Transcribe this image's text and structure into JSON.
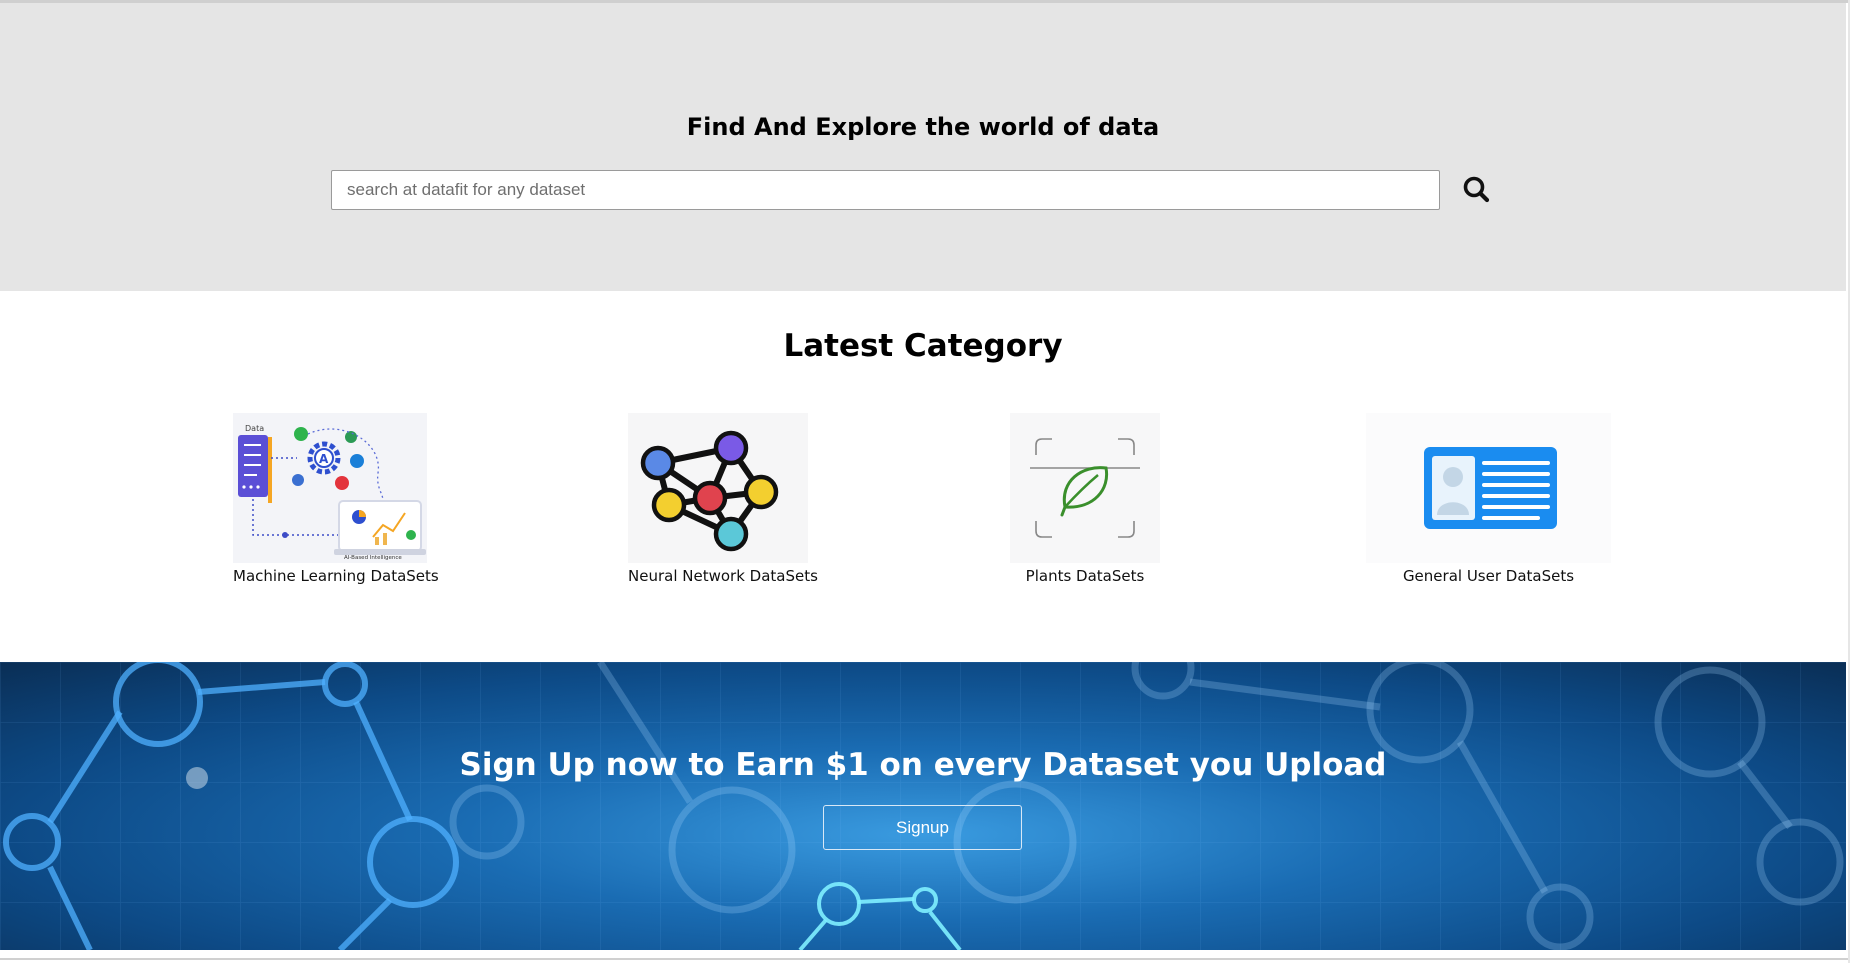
{
  "hero": {
    "title": "Find And Explore the world of data",
    "search_placeholder": "search at datafit for any dataset",
    "search_icon": "search-icon"
  },
  "categories": {
    "title": "Latest Category",
    "items": [
      {
        "label": "Machine Learning DataSets",
        "icon": "machine-learning-illustration"
      },
      {
        "label": "Neural Network DataSets",
        "icon": "neural-network-icon"
      },
      {
        "label": "Plants DataSets",
        "icon": "leaf-icon"
      },
      {
        "label": "General User DataSets",
        "icon": "id-card-icon"
      }
    ]
  },
  "banner": {
    "title": "Sign Up now to Earn $1 on every Dataset you Upload",
    "signup_label": "Signup"
  },
  "colors": {
    "hero_bg": "#e5e5e5",
    "banner_bg": "#1a6cb3",
    "id_card_blue": "#1a8cf0"
  }
}
